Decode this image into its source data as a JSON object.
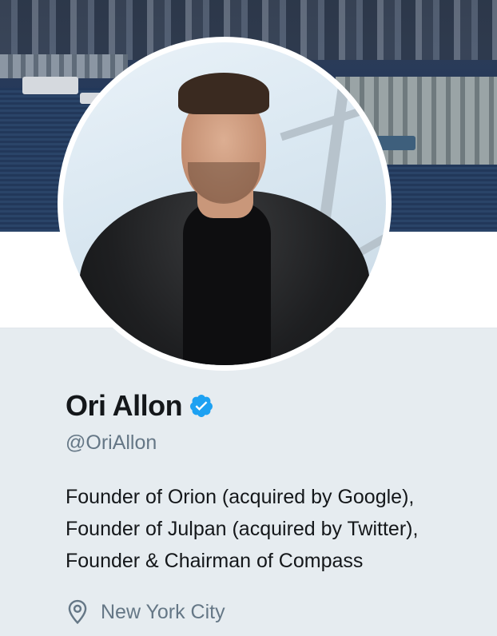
{
  "profile": {
    "name": "Ori Allon",
    "verified": true,
    "handle": "@OriAllon",
    "bio_lines": [
      "Founder of Orion (acquired by Google),",
      "Founder of Julpan (acquired by Twitter),",
      "Founder & Chairman of Compass"
    ],
    "location": "New York City",
    "icons": {
      "verified": "verified-badge-icon",
      "location": "location-pin-icon"
    }
  },
  "colors": {
    "verified_blue": "#1da1f2",
    "secondary_text": "#657786",
    "primary_text": "#14171a",
    "background": "#e6ecf0"
  }
}
